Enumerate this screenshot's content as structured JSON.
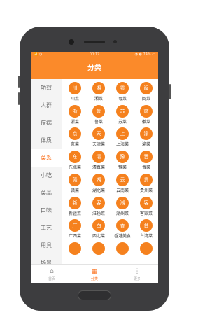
{
  "status_bar": {
    "left": "📶 ◔",
    "time": "00:17",
    "right": "◔ ◐ 74% ▭"
  },
  "header": {
    "title": "分类"
  },
  "sidebar": {
    "items": [
      {
        "label": "功效"
      },
      {
        "label": "人群"
      },
      {
        "label": "疾病"
      },
      {
        "label": "体质"
      },
      {
        "label": "菜系",
        "active": true
      },
      {
        "label": "小吃"
      },
      {
        "label": "菜品"
      },
      {
        "label": "口味"
      },
      {
        "label": "工艺"
      },
      {
        "label": "用具"
      },
      {
        "label": "场景"
      }
    ]
  },
  "cuisines": [
    {
      "icon": "川",
      "name": "川菜"
    },
    {
      "icon": "湘",
      "name": "湘菜"
    },
    {
      "icon": "粤",
      "name": "粤菜"
    },
    {
      "icon": "闽",
      "name": "闽菜"
    },
    {
      "icon": "浙",
      "name": "浙菜"
    },
    {
      "icon": "鲁",
      "name": "鲁菜"
    },
    {
      "icon": "苏",
      "name": "苏菜"
    },
    {
      "icon": "徽",
      "name": "徽菜"
    },
    {
      "icon": "京",
      "name": "京菜"
    },
    {
      "icon": "天",
      "name": "天津菜"
    },
    {
      "icon": "上",
      "name": "上海菜"
    },
    {
      "icon": "渝",
      "name": "渝菜"
    },
    {
      "icon": "东",
      "name": "东北菜"
    },
    {
      "icon": "清",
      "name": "清真菜"
    },
    {
      "icon": "豫",
      "name": "豫菜"
    },
    {
      "icon": "晋",
      "name": "晋菜"
    },
    {
      "icon": "赣",
      "name": "赣菜"
    },
    {
      "icon": "湖",
      "name": "湖北菜"
    },
    {
      "icon": "云",
      "name": "云南菜"
    },
    {
      "icon": "贵",
      "name": "贵州菜"
    },
    {
      "icon": "新",
      "name": "新疆菜"
    },
    {
      "icon": "客",
      "name": "淮扬菜"
    },
    {
      "icon": "潮",
      "name": "潮州菜"
    },
    {
      "icon": "客",
      "name": "客家菜"
    },
    {
      "icon": "广",
      "name": "广西菜"
    },
    {
      "icon": "西",
      "name": "西北菜"
    },
    {
      "icon": "香",
      "name": "香港美食"
    },
    {
      "icon": "台",
      "name": "台湾菜"
    },
    {
      "icon": "",
      "name": ""
    },
    {
      "icon": "",
      "name": ""
    },
    {
      "icon": "",
      "name": ""
    },
    {
      "icon": "",
      "name": ""
    }
  ],
  "tabbar": {
    "items": [
      {
        "icon": "⌂",
        "label": "首页",
        "icon_name": "home-icon"
      },
      {
        "icon": "▦",
        "label": "分类",
        "icon_name": "category-icon",
        "active": true
      },
      {
        "icon": "⋮",
        "label": "更多",
        "icon_name": "more-icon"
      }
    ]
  },
  "colors": {
    "accent": "#fb8a2a",
    "circle": "#f5811e",
    "active_text": "#fb6a12"
  }
}
